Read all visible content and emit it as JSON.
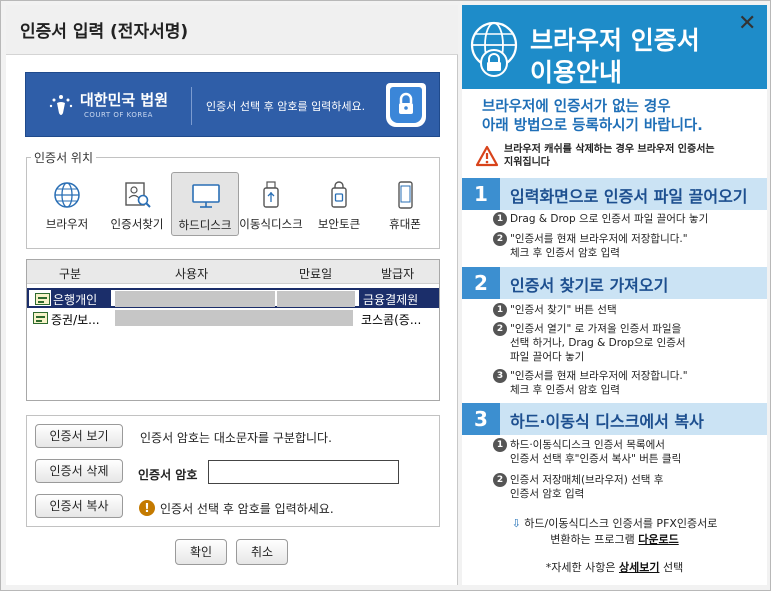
{
  "dialog": {
    "title": "인증서 입력 (전자서명)"
  },
  "banner": {
    "court_name": "대한민국 법원",
    "court_eng": "COURT OF KOREA",
    "message": "인증서 선택 후 암호를 입력하세요."
  },
  "location": {
    "legend": "인증서 위치",
    "items": [
      {
        "label": "브라우저",
        "icon": "globe-icon"
      },
      {
        "label": "인증서찾기",
        "icon": "cert-search-icon"
      },
      {
        "label": "하드디스크",
        "icon": "monitor-icon"
      },
      {
        "label": "이동식디스크",
        "icon": "usb-icon"
      },
      {
        "label": "보안토큰",
        "icon": "token-lock-icon"
      },
      {
        "label": "휴대폰",
        "icon": "phone-icon"
      }
    ],
    "selected": "하드디스크"
  },
  "cert_table": {
    "headers": [
      "구분",
      "사용자",
      "만료일",
      "발급자"
    ],
    "rows": [
      {
        "type": "은행개인",
        "user": "",
        "expiry": "",
        "issuer": "금융결제원"
      },
      {
        "type": "증권/보...",
        "user": "",
        "expiry": "",
        "issuer": "코스콤(증..."
      }
    ]
  },
  "actions": {
    "view_button": "인증서 보기",
    "delete_button": "인증서 삭제",
    "copy_button": "인증서 복사",
    "case_note": "인증서 암호는 대소문자를 구분합니다.",
    "password_label": "인증서 암호",
    "password_value": "",
    "warning_note": "인증서 선택 후 암호를 입력하세요.",
    "ok_button": "확인",
    "cancel_button": "취소"
  },
  "guide": {
    "title_line1": "브라우저 인증서",
    "title_line2": "이용안내",
    "subtitle_line1": "브라우저에 인증서가 없는 경우",
    "subtitle_line2": "아래 방법으로 등록하시기 바랍니다.",
    "warning_line1": "브라우저 캐쉬를 삭제하는 경우 브라우저 인증서는",
    "warning_line2": "지워집니다",
    "steps": [
      {
        "num": "1",
        "title": "입력화면으로 인증서 파일 끌어오기",
        "items": [
          {
            "n": "1",
            "lines": [
              "Drag & Drop 으로 인증서 파일 끌어다 놓기"
            ]
          },
          {
            "n": "2",
            "lines": [
              "\"인증서를 현재 브라우저에 저장합니다.\"",
              "체크 후 인증서 암호 입력"
            ]
          }
        ]
      },
      {
        "num": "2",
        "title": "인증서 찾기로 가져오기",
        "items": [
          {
            "n": "1",
            "lines": [
              "\"인증서 찾기\" 버튼 선택"
            ]
          },
          {
            "n": "2",
            "lines": [
              "\"인증서 열기\" 로 가져올 인증서 파일을",
              "선택 하거나, Drag & Drop으로 인증서",
              "파일 끌어다 놓기"
            ]
          },
          {
            "n": "3",
            "lines": [
              "\"인증서를 현재 브라우저에 저장합니다.\"",
              "체크 후 인증서 암호 입력"
            ]
          }
        ]
      },
      {
        "num": "3",
        "title": "하드·이동식 디스크에서 복사",
        "items": [
          {
            "n": "1",
            "lines": [
              "하드·이동식디스크 인증서 목록에서",
              "인증서 선택 후\"인증서 복사\" 버튼 클릭"
            ]
          },
          {
            "n": "2",
            "lines": [
              "인증서 저장매체(브라우저) 선택 후",
              "인증서 암호 입력"
            ]
          }
        ]
      }
    ],
    "download_text": "하드/이동식디스크 인증서를 PFX인증서로",
    "download_text2": "변환하는 프로그램",
    "download_link": "다운로드",
    "detail_prefix": "*자세한 사항은",
    "detail_link": "상세보기",
    "detail_suffix": "선택"
  }
}
